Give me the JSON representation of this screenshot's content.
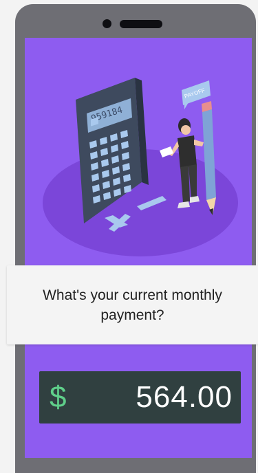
{
  "calculator": {
    "display": "959184"
  },
  "speech_bubble": {
    "text": "PAYOFF"
  },
  "question": {
    "text": "What's your current monthly payment?"
  },
  "payment": {
    "currency_symbol": "$",
    "amount": "564.00"
  },
  "colors": {
    "screen": "#8e5cf0",
    "card": "#f4f4f4",
    "amount_box": "#304040",
    "currency_symbol": "#5fcf8a",
    "phone_frame": "#6e6e74"
  }
}
